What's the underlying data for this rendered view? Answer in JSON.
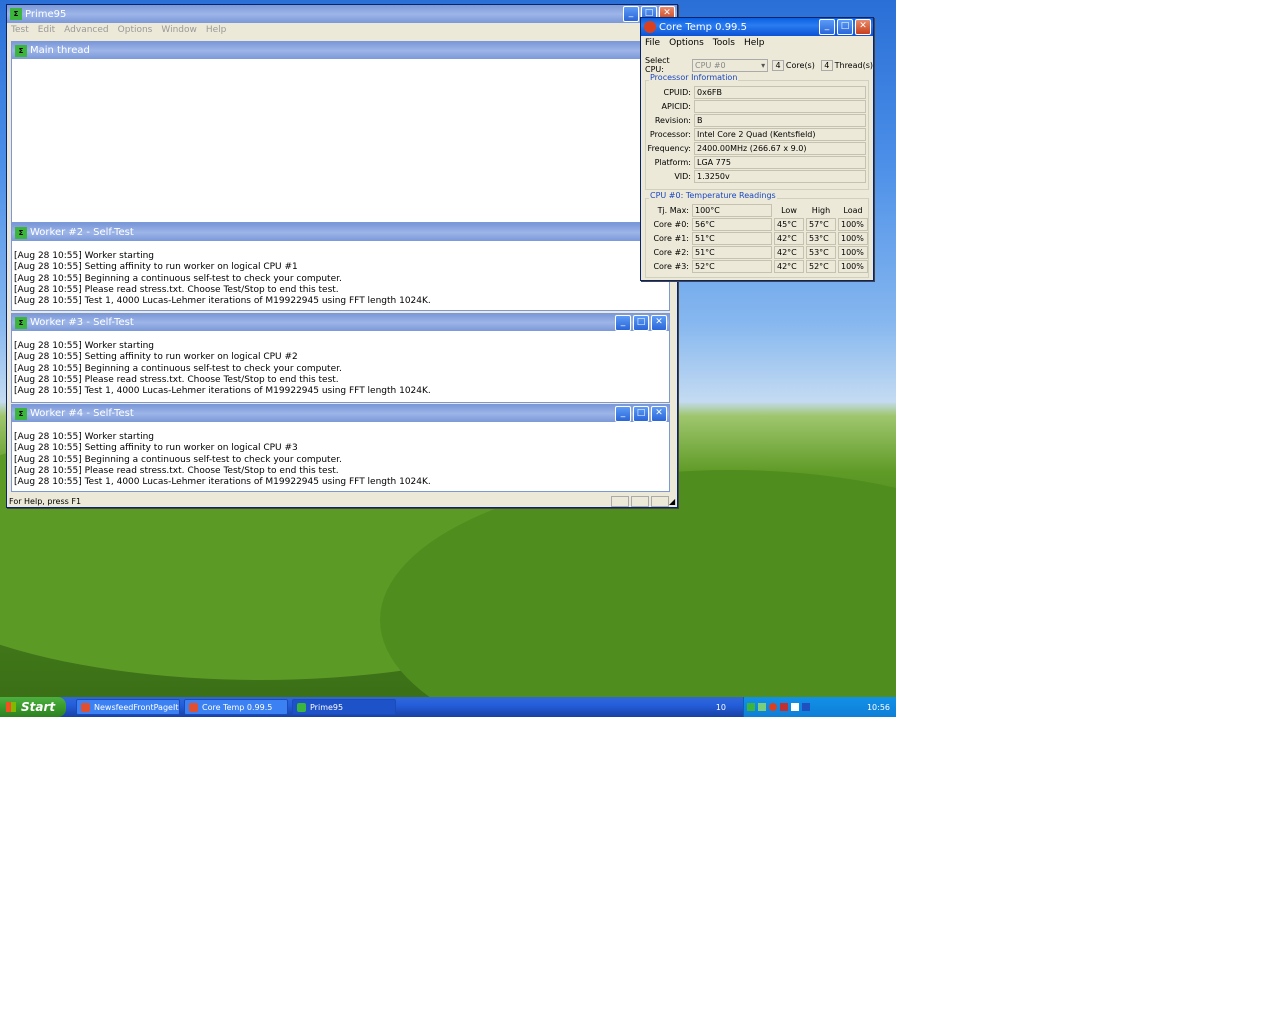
{
  "prime95": {
    "title": "Prime95",
    "menu": [
      "Test",
      "Edit",
      "Advanced",
      "Options",
      "Window",
      "Help"
    ],
    "icon_text": "Σ",
    "main_thread": {
      "title": "Main thread"
    },
    "workers": [
      {
        "title": "Worker #2 - Self-Test",
        "lines": [
          "[Aug 28 10:55] Worker starting",
          "[Aug 28 10:55] Setting affinity to run worker on logical CPU #1",
          "[Aug 28 10:55] Beginning a continuous self-test to check your computer.",
          "[Aug 28 10:55] Please read stress.txt.  Choose Test/Stop to end this test.",
          "[Aug 28 10:55] Test 1, 4000 Lucas-Lehmer iterations of M19922945 using FFT length 1024K."
        ]
      },
      {
        "title": "Worker #3 - Self-Test",
        "lines": [
          "[Aug 28 10:55] Worker starting",
          "[Aug 28 10:55] Setting affinity to run worker on logical CPU #2",
          "[Aug 28 10:55] Beginning a continuous self-test to check your computer.",
          "[Aug 28 10:55] Please read stress.txt.  Choose Test/Stop to end this test.",
          "[Aug 28 10:55] Test 1, 4000 Lucas-Lehmer iterations of M19922945 using FFT length 1024K."
        ]
      },
      {
        "title": "Worker #4 - Self-Test",
        "lines": [
          "[Aug 28 10:55] Worker starting",
          "[Aug 28 10:55] Setting affinity to run worker on logical CPU #3",
          "[Aug 28 10:55] Beginning a continuous self-test to check your computer.",
          "[Aug 28 10:55] Please read stress.txt.  Choose Test/Stop to end this test.",
          "[Aug 28 10:55] Test 1, 4000 Lucas-Lehmer iterations of M19922945 using FFT length 1024K."
        ]
      }
    ],
    "status": "For Help, press F1"
  },
  "coretemp": {
    "title": "Core Temp 0.99.5",
    "menu": [
      "File",
      "Options",
      "Tools",
      "Help"
    ],
    "select_cpu_label": "Select CPU:",
    "select_cpu_value": "CPU #0",
    "cores_value": "4",
    "cores_label": "Core(s)",
    "threads_value": "4",
    "threads_label": "Thread(s)",
    "proc_group_title": "Processor Information",
    "proc_info": [
      {
        "label": "CPUID:",
        "value": "0x6FB"
      },
      {
        "label": "APICID:",
        "value": ""
      },
      {
        "label": "Revision:",
        "value": "B"
      },
      {
        "label": "Processor:",
        "value": "Intel Core 2 Quad (Kentsfield)"
      },
      {
        "label": "Frequency:",
        "value": "2400.00MHz (266.67 x 9.0)"
      },
      {
        "label": "Platform:",
        "value": "LGA 775"
      },
      {
        "label": "VID:",
        "value": "1.3250v"
      }
    ],
    "temp_group_title": "CPU #0: Temperature Readings",
    "tjmax_label": "Tj. Max:",
    "tjmax_value": "100°C",
    "headers": [
      "Low",
      "High",
      "Load"
    ],
    "cores": [
      {
        "label": "Core #0:",
        "temp": "56°C",
        "low": "45°C",
        "high": "57°C",
        "load": "100%"
      },
      {
        "label": "Core #1:",
        "temp": "51°C",
        "low": "42°C",
        "high": "53°C",
        "load": "100%"
      },
      {
        "label": "Core #2:",
        "temp": "51°C",
        "low": "42°C",
        "high": "53°C",
        "load": "100%"
      },
      {
        "label": "Core #3:",
        "temp": "52°C",
        "low": "42°C",
        "high": "52°C",
        "load": "100%"
      }
    ]
  },
  "taskbar": {
    "start_label": "Start",
    "tasks": [
      "NewsfeedFrontPageIt & ...",
      "Core Temp 0.99.5",
      "Prime95"
    ],
    "tray_text": "10",
    "clock": "10:56"
  }
}
